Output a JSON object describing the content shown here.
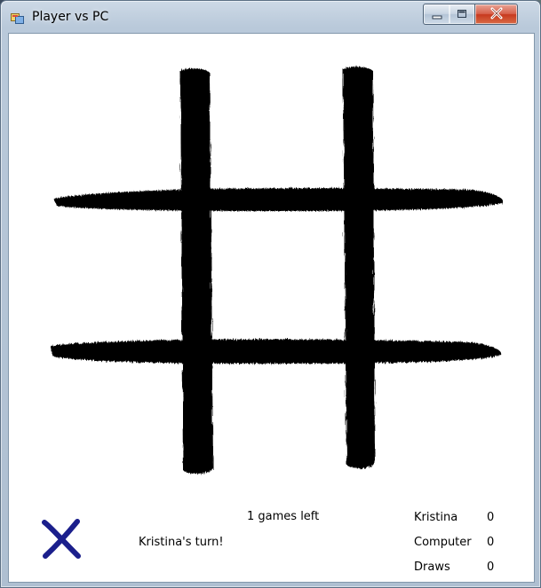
{
  "window": {
    "title": "Player vs PC"
  },
  "status": {
    "games_left": "1 games left",
    "turn_text": "Kristina's turn!",
    "current_mark": "X"
  },
  "scores": [
    {
      "name": "Kristina",
      "value": "0"
    },
    {
      "name": "Computer",
      "value": "0"
    },
    {
      "name": "Draws",
      "value": "0"
    }
  ],
  "icons": {
    "app": "app-window-icon",
    "minimize": "minimize-icon",
    "maximize": "maximize-icon",
    "close": "close-icon"
  },
  "colors": {
    "board_lines": "#000000",
    "x_mark": "#1b1f8c",
    "close_button": "#c7391f"
  }
}
